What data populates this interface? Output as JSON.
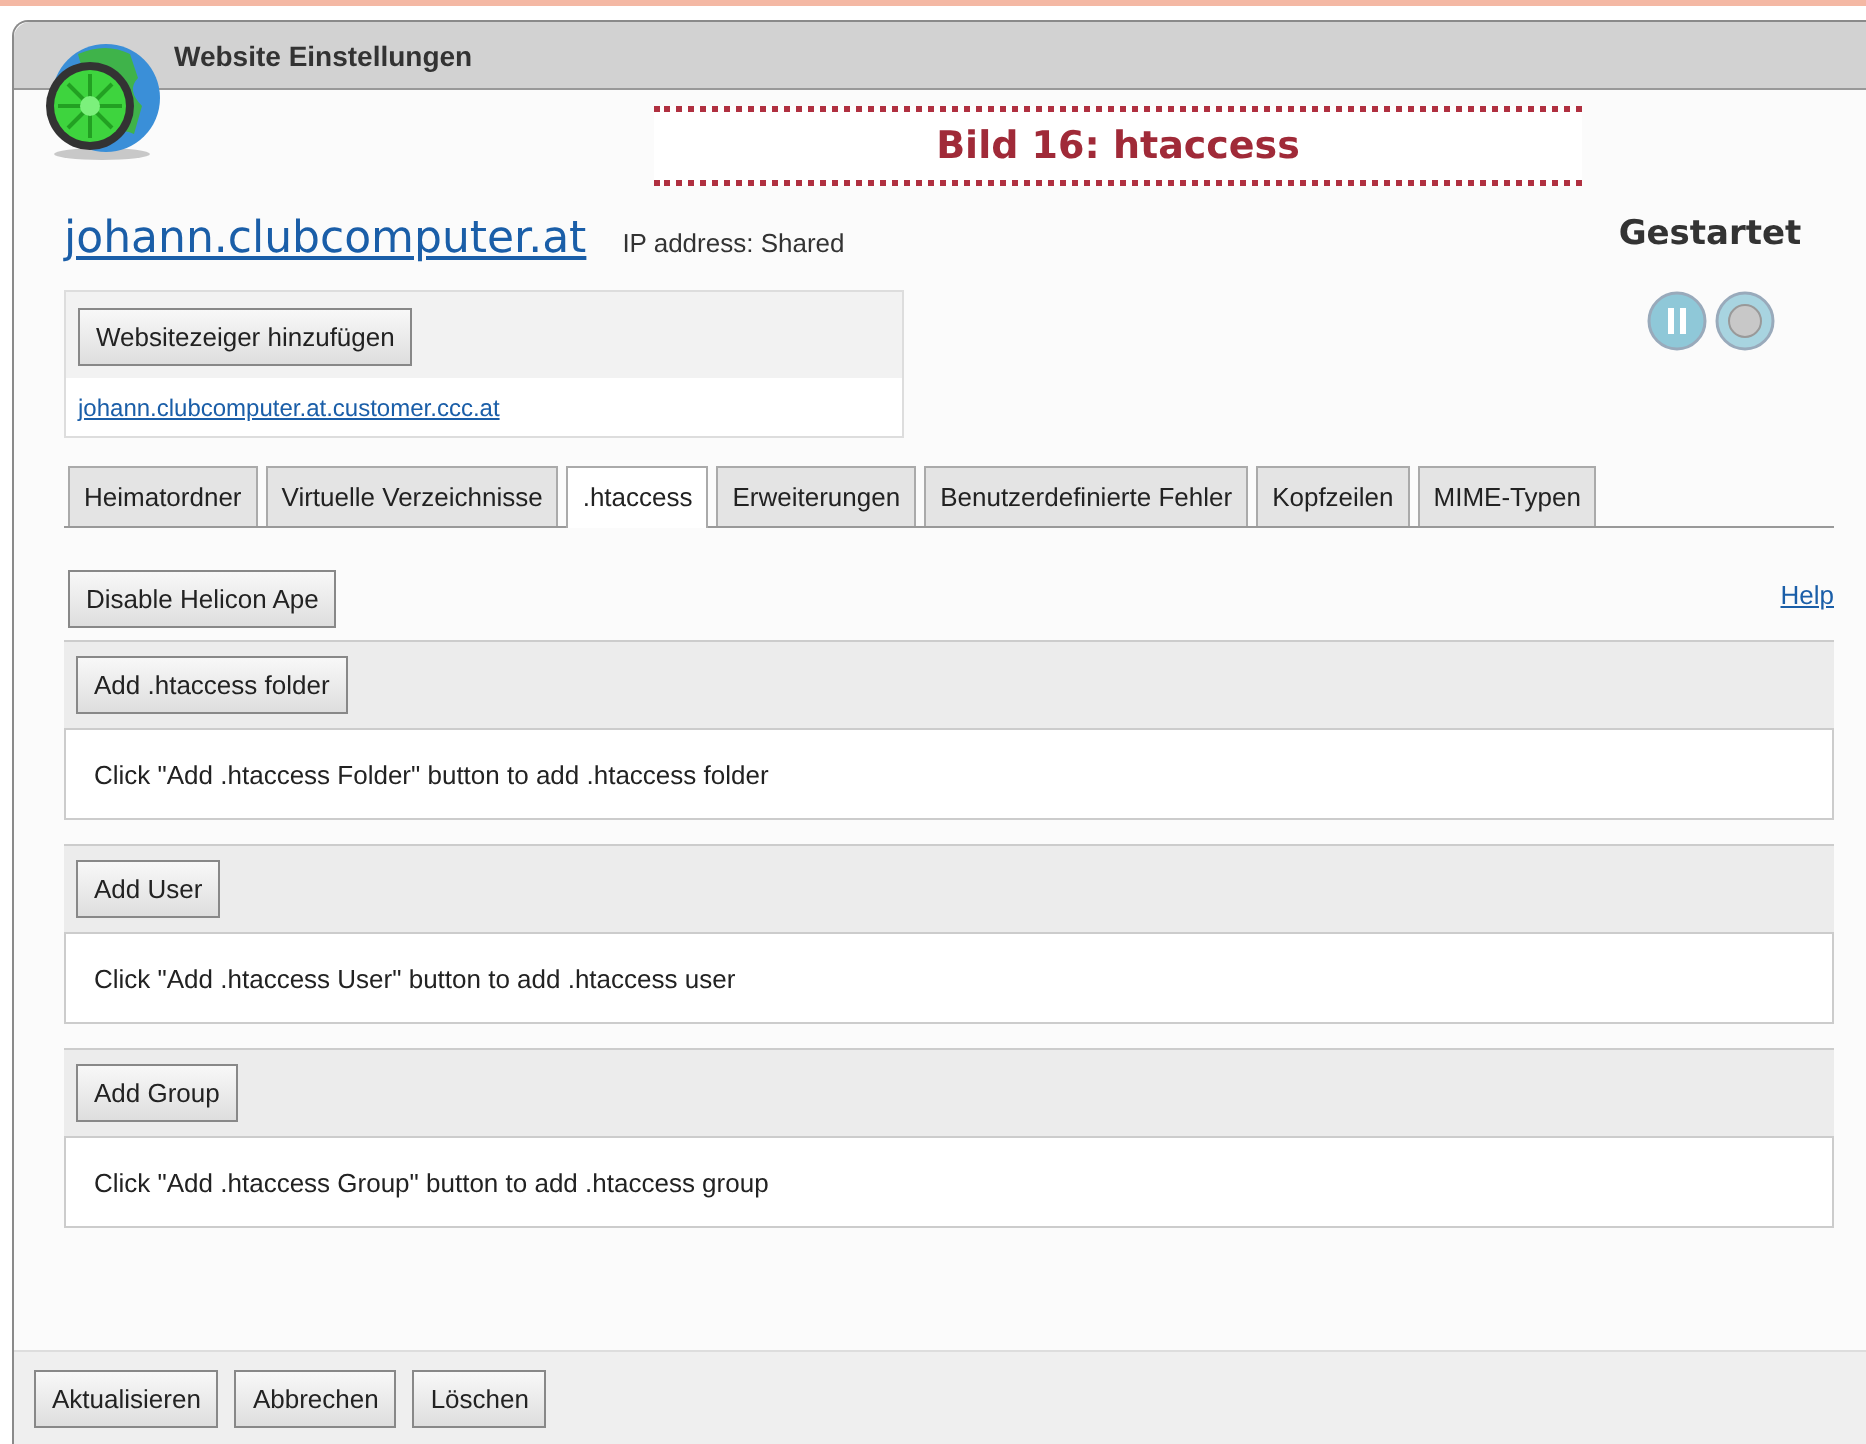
{
  "caption": "Bild 16: htaccess",
  "window": {
    "title": "Website Einstellungen"
  },
  "site": {
    "name": "johann.clubcomputer.at",
    "ip": "IP address: Shared",
    "status": "Gestartet",
    "pointer_button": "Websitezeiger hinzufügen",
    "pointers": [
      "johann.clubcomputer.at.customer.ccc.at"
    ]
  },
  "tabs": [
    {
      "label": "Heimatordner",
      "selected": false
    },
    {
      "label": "Virtuelle Verzeichnisse",
      "selected": false
    },
    {
      "label": ".htaccess",
      "selected": true
    },
    {
      "label": "Erweiterungen",
      "selected": false
    },
    {
      "label": "Benutzerdefinierte Fehler",
      "selected": false
    },
    {
      "label": "Kopfzeilen",
      "selected": false
    },
    {
      "label": "MIME-Typen",
      "selected": false
    }
  ],
  "toolbar": {
    "button": "Disable Helicon Ape",
    "help": "Help"
  },
  "sections": [
    {
      "button": "Add .htaccess folder",
      "message": "Click \"Add .htaccess Folder\" button to add .htaccess folder"
    },
    {
      "button": "Add User",
      "message": "Click \"Add .htaccess User\" button to add .htaccess user"
    },
    {
      "button": "Add Group",
      "message": "Click \"Add .htaccess Group\" button to add .htaccess group"
    }
  ],
  "footer_buttons": [
    "Aktualisieren",
    "Abbrechen",
    "Löschen"
  ]
}
